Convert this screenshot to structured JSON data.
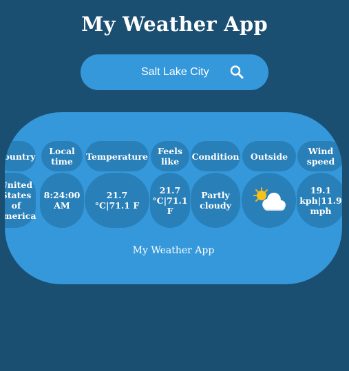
{
  "app": {
    "title": "My Weather App"
  },
  "search": {
    "value": "Salt Lake City",
    "placeholder": ""
  },
  "table": {
    "headers": [
      "Country",
      "Local time",
      "Temperature",
      "Feels like",
      "Condition",
      "Outside",
      "Wind speed"
    ],
    "values": {
      "country": "United States of America",
      "local_time": "8:24:00 AM",
      "temperature": "21.7 °C|71.1 F",
      "feels_like": "21.7 °C|71.1 F",
      "condition": "Partly cloudy",
      "outside_icon": "partly-cloudy-icon",
      "wind_speed": "19.1 kph|11.9 mph"
    }
  },
  "footer": {
    "text": "My Weather App"
  },
  "colors": {
    "background": "#1b4f72",
    "panel": "#3498db",
    "cell": "#2980b9",
    "text": "#ffffff"
  }
}
